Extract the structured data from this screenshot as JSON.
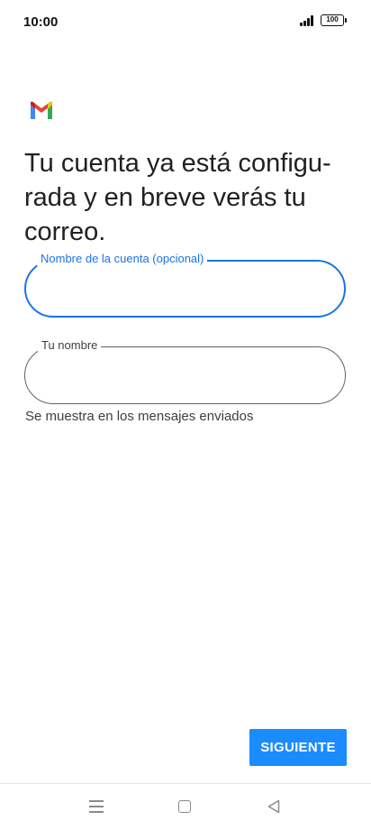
{
  "status_bar": {
    "time": "10:00",
    "battery": "100",
    "icons": [
      "signal-icon",
      "battery-icon"
    ]
  },
  "logo": {
    "icon": "gmail-icon"
  },
  "title": "Tu cuenta ya está configu-rada y en breve verás tu correo.",
  "title_lines": [
    "Tu cuenta ya está configu-",
    "rada y en breve verás tu",
    "correo."
  ],
  "fields": {
    "account_name": {
      "label": "Nombre de la cuenta (opcional)",
      "value": ""
    },
    "your_name": {
      "label": "Tu nombre",
      "value": "",
      "helper": "Se muestra en los mensajes enviados"
    }
  },
  "actions": {
    "next_label": "SIGUIENTE"
  },
  "nav_bar": {
    "icons": [
      "menu-icon",
      "home-icon",
      "back-icon"
    ]
  },
  "colors": {
    "accent": "#1a73e8",
    "button": "#1a8cff",
    "text": "#202124"
  }
}
